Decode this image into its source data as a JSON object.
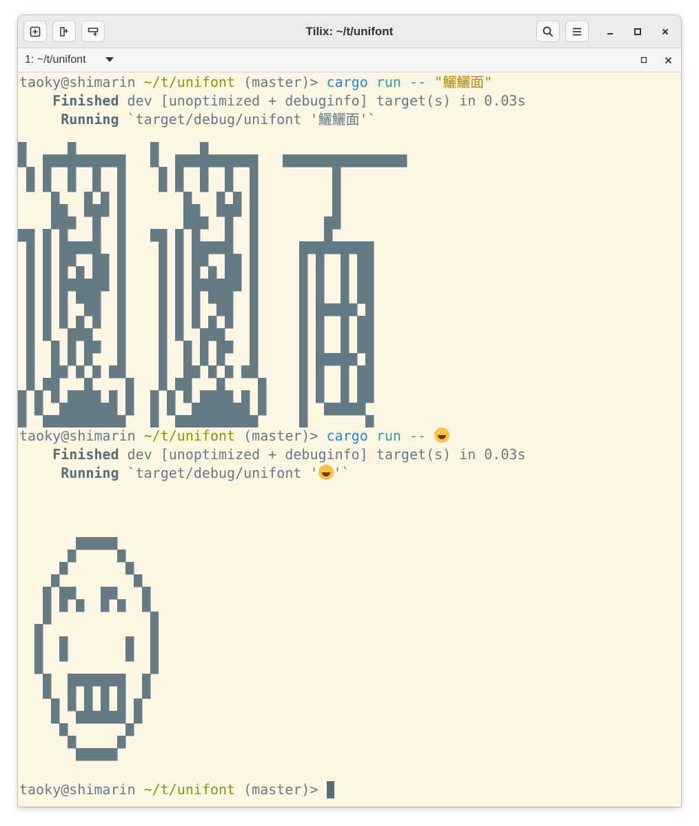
{
  "window": {
    "title": "Tilix: ~/t/unifont",
    "tab_label": "1: ~/t/unifont"
  },
  "colors": {
    "background": "#fdf6e3",
    "foreground": "#586e75",
    "prompt_path": "#859900",
    "command": "#268bd2",
    "argument": "#2aa198",
    "string": "#b58900",
    "glyph_pixels": "#657b83"
  },
  "icons": {
    "new_session": "add-terminal-icon",
    "split_right": "split-vertical-icon",
    "split_down": "split-horizontal-icon",
    "search": "search-icon",
    "menu": "hamburger-menu-icon",
    "minimize": "minimize-icon",
    "maximize": "maximize-icon",
    "close": "close-icon"
  },
  "terminal": {
    "prompt": {
      "user": "taoky@shimarin",
      "path": "~/t/unifont",
      "branch": "(master)>"
    },
    "session1": {
      "cmd": "cargo",
      "sub": "run",
      "dashes": "--",
      "arg": "\"鱺鱺面\"",
      "finished_label": "Finished",
      "finished_text": "dev [unoptimized + debuginfo] target(s) in 0.03s",
      "running_label": "Running",
      "running_text": "`target/debug/unifont '鱺鱺面'`"
    },
    "session2": {
      "cmd": "cargo",
      "sub": "run",
      "dashes": "--",
      "finished_label": "Finished",
      "finished_text": "dev [unoptimized + debuginfo] target(s) in 0.03s",
      "running_label": "Running",
      "running_pre": "`target/debug/unifont '",
      "running_post": "'`"
    }
  }
}
